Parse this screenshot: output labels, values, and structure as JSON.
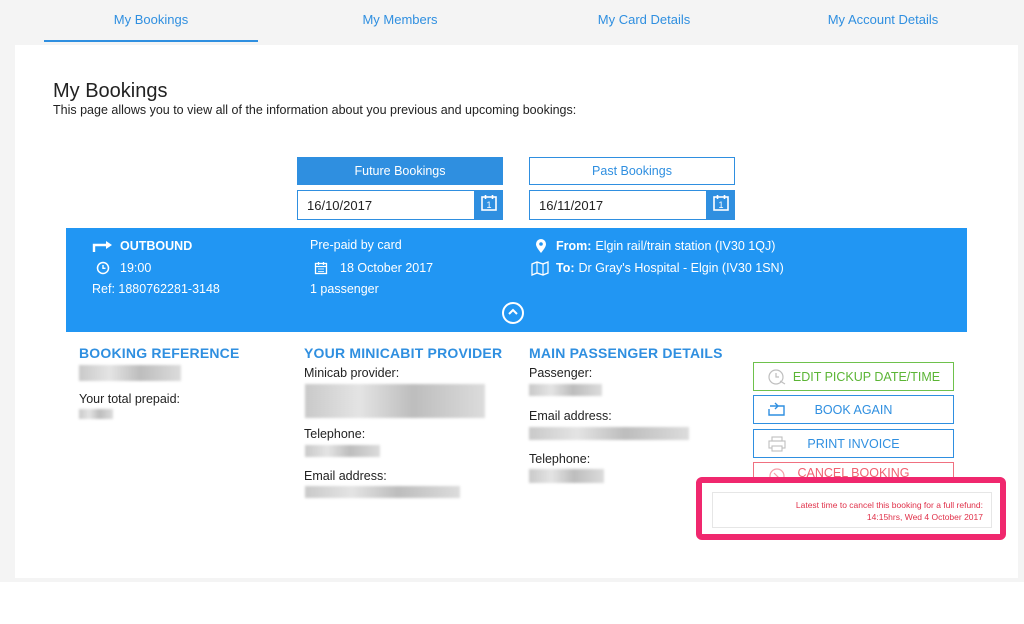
{
  "nav": {
    "tabs": [
      {
        "label": "My Bookings"
      },
      {
        "label": "My Members"
      },
      {
        "label": "My Card Details"
      },
      {
        "label": "My Account Details"
      }
    ]
  },
  "page": {
    "title": "My Bookings",
    "subtitle": "This page allows you to view all of the information about you previous and upcoming bookings:"
  },
  "filters": {
    "future_label": "Future Bookings",
    "past_label": "Past Bookings",
    "future_date": "16/10/2017",
    "past_date": "16/11/2017",
    "calendar_glyph": "1"
  },
  "booking": {
    "direction": "OUTBOUND",
    "time": "19:00",
    "ref": "Ref: 1880762281-3148",
    "payment": "Pre-paid by card",
    "date": "18 October 2017",
    "passengers": "1 passenger",
    "from_label": "From:",
    "from_value": "Elgin rail/train station (IV30 1QJ)",
    "to_label": "To:",
    "to_value": "Dr Gray's Hospital - Elgin (IV30 1SN)"
  },
  "details": {
    "ref_heading": "BOOKING REFERENCE",
    "total_label": "Your total prepaid:",
    "provider_heading": "YOUR MINICABIT PROVIDER",
    "provider_label": "Minicab provider:",
    "provider_phone_label": "Telephone:",
    "provider_email_label": "Email address:",
    "passenger_heading": "MAIN PASSENGER DETAILS",
    "passenger_label": "Passenger:",
    "passenger_email_label": "Email address:",
    "passenger_phone_label": "Telephone:"
  },
  "actions": {
    "edit": "EDIT PICKUP DATE/TIME",
    "again": "BOOK AGAIN",
    "invoice": "PRINT INVOICE",
    "cancel": "CANCEL BOOKING"
  },
  "refund": {
    "line1": "Latest time to cancel this booking for a full refund:",
    "line2": "14:15hrs, Wed 4 October 2017"
  },
  "colors": {
    "accent": "#2f8fe0",
    "banner": "#2196f3",
    "green": "#5bb535",
    "red": "#f06272",
    "highlight": "#f0286e"
  },
  "icons": [
    "arrow-right-icon",
    "clock-icon",
    "calendar-icon",
    "location-pin-icon",
    "map-icon",
    "chevron-up-icon",
    "clock-edit-icon",
    "repeat-icon",
    "printer-icon",
    "cancel-icon"
  ]
}
